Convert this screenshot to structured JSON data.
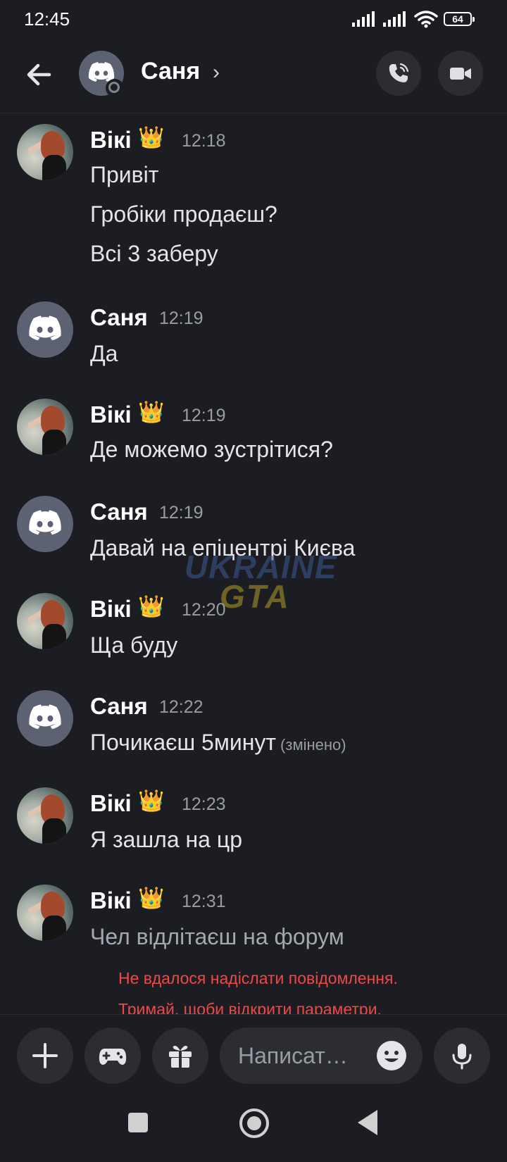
{
  "status_bar": {
    "time": "12:45",
    "battery": "64"
  },
  "header": {
    "name": "Саня",
    "chevron": "›"
  },
  "colors": {
    "background": "#1c1d22",
    "error": "#f04747",
    "avatar_gray": "#5c6271"
  },
  "messages": [
    {
      "author": "Вікі",
      "crown": "👑",
      "time": "12:18",
      "lines": [
        "Привіт",
        "Гробіки продаєш?",
        "Всі 3 заберу"
      ]
    },
    {
      "author": "Саня",
      "time": "12:19",
      "lines": [
        "Да"
      ]
    },
    {
      "author": "Вікі",
      "crown": "👑",
      "time": "12:19",
      "lines": [
        "Де можемо зустрітися?"
      ]
    },
    {
      "author": "Саня",
      "time": "12:19",
      "lines": [
        "Давай на епіцентрі Києва"
      ]
    },
    {
      "author": "Вікі",
      "crown": "👑",
      "time": "12:20",
      "lines": [
        "Ща буду"
      ]
    },
    {
      "author": "Саня",
      "time": "12:22",
      "lines": [
        "Почикаєш 5минут"
      ],
      "edited": "(змінено)"
    },
    {
      "author": "Вікі",
      "crown": "👑",
      "time": "12:23",
      "lines": [
        "Я зашла на цр"
      ]
    },
    {
      "author": "Вікі",
      "crown": "👑",
      "time": "12:31",
      "lines": [
        "Чел відлітаєш на форум"
      ]
    }
  ],
  "send_error": [
    "Не вдалося надіслати повідомлення.",
    "Тримай, щоби відкрити параметри."
  ],
  "watermark": {
    "line1": "UKRAINE",
    "line2": "GTA"
  },
  "composer": {
    "placeholder": "Написат…"
  },
  "icons": [
    "back-arrow-icon",
    "discord-icon",
    "phone-icon",
    "video-camera-icon",
    "plus-icon",
    "gamepad-icon",
    "gift-icon",
    "emoji-icon",
    "microphone-icon"
  ]
}
